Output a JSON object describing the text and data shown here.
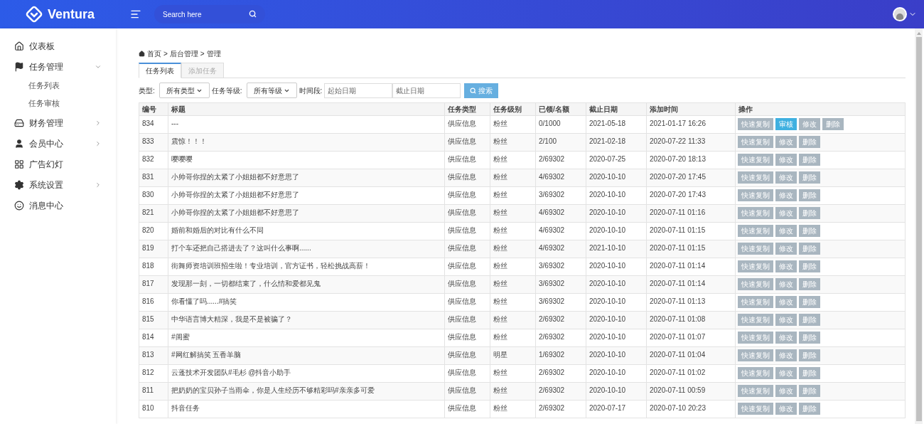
{
  "header": {
    "brand": "Ventura",
    "search": {
      "placeholder": "Search here"
    }
  },
  "sidebar": {
    "items": [
      {
        "label": "仪表板"
      },
      {
        "label": "任务管理",
        "expanded": true,
        "children": [
          {
            "label": "任务列表"
          },
          {
            "label": "任务审核"
          }
        ]
      },
      {
        "label": "财务管理",
        "expanded": false
      },
      {
        "label": "会员中心",
        "expanded": false
      },
      {
        "label": "广告幻灯"
      },
      {
        "label": "系统设置",
        "expanded": false
      },
      {
        "label": "消息中心"
      }
    ]
  },
  "breadcrumb": [
    "首页",
    ">",
    "后台管理",
    ">",
    "管理"
  ],
  "tabs": [
    {
      "label": "任务列表",
      "selected": true
    },
    {
      "label": "添加任务",
      "selected": false
    }
  ],
  "filters": {
    "type_label": "类型:",
    "type_value": "所有类型",
    "level_label": "任务等级:",
    "level_value": "所有等级",
    "period_label": "时间段:",
    "start_placeholder": "起始日期",
    "end_placeholder": "截止日期",
    "search_button": "搜索"
  },
  "table": {
    "columns": [
      "编号",
      "标题",
      "任务类型",
      "任务级别",
      "已领/名额",
      "截止日期",
      "添加时间",
      "操作"
    ],
    "rows": [
      {
        "cells": [
          "834",
          "---",
          "供应信息",
          "粉丝",
          "0/1000",
          "2021-05-18",
          "2021-01-17 16:26"
        ],
        "actions": [
          {
            "kind": "copy",
            "label": "快速复制"
          },
          {
            "kind": "review",
            "label": "审核"
          },
          {
            "kind": "edit",
            "label": "修改"
          },
          {
            "kind": "delete",
            "label": "删除"
          }
        ]
      },
      {
        "cells": [
          "833",
          "震惊！！！",
          "供应信息",
          "粉丝",
          "2/100",
          "2021-02-18",
          "2020-07-22 11:33"
        ],
        "actions": [
          {
            "kind": "copy",
            "label": "快速复制"
          },
          {
            "kind": "edit",
            "label": "修改"
          },
          {
            "kind": "delete",
            "label": "删除"
          }
        ]
      },
      {
        "cells": [
          "832",
          "嘤嘤嘤",
          "供应信息",
          "粉丝",
          "2/69302",
          "2020-07-25",
          "2020-07-20 18:13"
        ],
        "actions": [
          {
            "kind": "copy",
            "label": "快速复制"
          },
          {
            "kind": "edit",
            "label": "修改"
          },
          {
            "kind": "delete",
            "label": "删除"
          }
        ]
      },
      {
        "cells": [
          "831",
          "小帅哥你捏的太紧了小姐姐都不好意思了",
          "供应信息",
          "粉丝",
          "4/69302",
          "2020-10-10",
          "2020-07-20 17:45"
        ],
        "actions": [
          {
            "kind": "copy",
            "label": "快速复制"
          },
          {
            "kind": "edit",
            "label": "修改"
          },
          {
            "kind": "delete",
            "label": "删除"
          }
        ]
      },
      {
        "cells": [
          "830",
          "小帅哥你捏的太紧了小姐姐都不好意思了",
          "供应信息",
          "粉丝",
          "3/69302",
          "2020-10-10",
          "2020-07-20 17:43"
        ],
        "actions": [
          {
            "kind": "copy",
            "label": "快速复制"
          },
          {
            "kind": "edit",
            "label": "修改"
          },
          {
            "kind": "delete",
            "label": "删除"
          }
        ]
      },
      {
        "cells": [
          "821",
          "小帅哥你捏的太紧了小姐姐都不好意思了",
          "供应信息",
          "粉丝",
          "4/69302",
          "2020-10-10",
          "2020-07-11 01:16"
        ],
        "actions": [
          {
            "kind": "copy",
            "label": "快速复制"
          },
          {
            "kind": "edit",
            "label": "修改"
          },
          {
            "kind": "delete",
            "label": "删除"
          }
        ]
      },
      {
        "cells": [
          "820",
          "婚前和婚后的对比有什么不同",
          "供应信息",
          "粉丝",
          "4/69302",
          "2020-10-10",
          "2020-07-11 01:15"
        ],
        "actions": [
          {
            "kind": "copy",
            "label": "快速复制"
          },
          {
            "kind": "edit",
            "label": "修改"
          },
          {
            "kind": "delete",
            "label": "删除"
          }
        ]
      },
      {
        "cells": [
          "819",
          "打个车还把自己搭进去了？这叫什么事啊......",
          "供应信息",
          "粉丝",
          "4/69302",
          "2021-10-10",
          "2020-07-11 01:15"
        ],
        "actions": [
          {
            "kind": "copy",
            "label": "快速复制"
          },
          {
            "kind": "edit",
            "label": "修改"
          },
          {
            "kind": "delete",
            "label": "删除"
          }
        ]
      },
      {
        "cells": [
          "818",
          "街舞师资培训班招生啦！专业培训，官方证书，轻松挑战高薪！",
          "供应信息",
          "粉丝",
          "3/69302",
          "2020-10-10",
          "2020-07-11 01:14"
        ],
        "actions": [
          {
            "kind": "copy",
            "label": "快速复制"
          },
          {
            "kind": "edit",
            "label": "修改"
          },
          {
            "kind": "delete",
            "label": "删除"
          }
        ]
      },
      {
        "cells": [
          "817",
          "发现那一刻，一切都结束了，什么情和爱都见鬼",
          "供应信息",
          "粉丝",
          "3/69302",
          "2020-10-10",
          "2020-07-11 01:14"
        ],
        "actions": [
          {
            "kind": "copy",
            "label": "快速复制"
          },
          {
            "kind": "edit",
            "label": "修改"
          },
          {
            "kind": "delete",
            "label": "删除"
          }
        ]
      },
      {
        "cells": [
          "816",
          "你看懂了吗......#搞笑",
          "供应信息",
          "粉丝",
          "3/69302",
          "2020-10-10",
          "2020-07-11 01:13"
        ],
        "actions": [
          {
            "kind": "copy",
            "label": "快速复制"
          },
          {
            "kind": "edit",
            "label": "修改"
          },
          {
            "kind": "delete",
            "label": "删除"
          }
        ]
      },
      {
        "cells": [
          "815",
          "中华语言博大精深，我是不是被骗了？",
          "供应信息",
          "粉丝",
          "2/69302",
          "2020-10-10",
          "2020-07-11 01:08"
        ],
        "actions": [
          {
            "kind": "copy",
            "label": "快速复制"
          },
          {
            "kind": "edit",
            "label": "修改"
          },
          {
            "kind": "delete",
            "label": "删除"
          }
        ]
      },
      {
        "cells": [
          "814",
          "#闺蜜",
          "供应信息",
          "粉丝",
          "2/69302",
          "2020-10-10",
          "2020-07-11 01:07"
        ],
        "actions": [
          {
            "kind": "copy",
            "label": "快速复制"
          },
          {
            "kind": "edit",
            "label": "修改"
          },
          {
            "kind": "delete",
            "label": "删除"
          }
        ]
      },
      {
        "cells": [
          "813",
          "#网红解搞笑 五香羊脑",
          "供应信息",
          "明星",
          "1/69302",
          "2020-10-10",
          "2020-07-11 01:04"
        ],
        "actions": [
          {
            "kind": "copy",
            "label": "快速复制"
          },
          {
            "kind": "edit",
            "label": "修改"
          },
          {
            "kind": "delete",
            "label": "删除"
          }
        ]
      },
      {
        "cells": [
          "812",
          "云蓬技术开发团队#毛杉 @抖音小助手",
          "供应信息",
          "粉丝",
          "2/69302",
          "2020-10-10",
          "2020-07-11 01:02"
        ],
        "actions": [
          {
            "kind": "copy",
            "label": "快速复制"
          },
          {
            "kind": "edit",
            "label": "修改"
          },
          {
            "kind": "delete",
            "label": "删除"
          }
        ]
      },
      {
        "cells": [
          "811",
          "把奶奶的宝贝孙子当雨伞，你是人生经历不够精彩吗#亲亲多可爱",
          "供应信息",
          "粉丝",
          "2/69302",
          "2020-10-10",
          "2020-07-11 00:59"
        ],
        "actions": [
          {
            "kind": "copy",
            "label": "快速复制"
          },
          {
            "kind": "edit",
            "label": "修改"
          },
          {
            "kind": "delete",
            "label": "删除"
          }
        ]
      },
      {
        "cells": [
          "810",
          "抖音任务",
          "供应信息",
          "粉丝",
          "2/69302",
          "2020-07-17",
          "2020-07-10 20:23"
        ],
        "actions": [
          {
            "kind": "copy",
            "label": "快速复制"
          },
          {
            "kind": "edit",
            "label": "修改"
          },
          {
            "kind": "delete",
            "label": "删除"
          }
        ]
      }
    ]
  }
}
